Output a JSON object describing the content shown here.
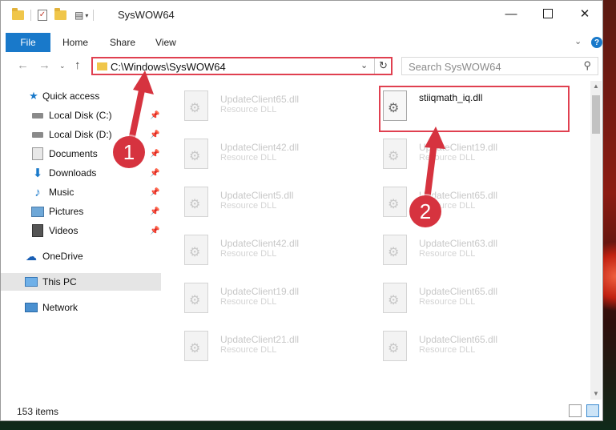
{
  "window": {
    "title": "SysWOW64"
  },
  "ribbon": {
    "tabs": [
      {
        "label": "File"
      },
      {
        "label": "Home"
      },
      {
        "label": "Share"
      },
      {
        "label": "View"
      }
    ]
  },
  "address": {
    "path": "C:\\Windows\\SysWOW64"
  },
  "search": {
    "placeholder": "Search SysWOW64"
  },
  "nav": {
    "items": [
      {
        "label": "Quick access",
        "icon": "star-icon",
        "pinned": false
      },
      {
        "label": "Local Disk (C:)",
        "icon": "drive-icon",
        "pinned": true
      },
      {
        "label": "Local Disk (D:)",
        "icon": "drive-icon",
        "pinned": true
      },
      {
        "label": "Documents",
        "icon": "documents-icon",
        "pinned": true
      },
      {
        "label": "Downloads",
        "icon": "download-icon",
        "pinned": true
      },
      {
        "label": "Music",
        "icon": "music-icon",
        "pinned": true
      },
      {
        "label": "Pictures",
        "icon": "pictures-icon",
        "pinned": true
      },
      {
        "label": "Videos",
        "icon": "videos-icon",
        "pinned": true
      },
      {
        "label": "OneDrive",
        "icon": "cloud-icon",
        "pinned": false
      },
      {
        "label": "This PC",
        "icon": "computer-icon",
        "pinned": false,
        "selected": true
      },
      {
        "label": "Network",
        "icon": "network-icon",
        "pinned": false
      }
    ]
  },
  "files": {
    "left": [
      {
        "name": "UpdateClient65.dll",
        "type": "Resource DLL"
      },
      {
        "name": "UpdateClient42.dll",
        "type": "Resource DLL"
      },
      {
        "name": "UpdateClient5.dll",
        "type": "Resource DLL"
      },
      {
        "name": "UpdateClient42.dll",
        "type": "Resource DLL"
      },
      {
        "name": "UpdateClient19.dll",
        "type": "Resource DLL"
      },
      {
        "name": "UpdateClient21.dll",
        "type": "Resource DLL"
      }
    ],
    "right": [
      {
        "name": "stiiqmath_iq.dll",
        "type": "",
        "highlighted": true
      },
      {
        "name": "UpdateClient19.dll",
        "type": "Resource DLL"
      },
      {
        "name": "UpdateClient65.dll",
        "type": "Resource DLL"
      },
      {
        "name": "UpdateClient63.dll",
        "type": "Resource DLL"
      },
      {
        "name": "UpdateClient65.dll",
        "type": "Resource DLL"
      },
      {
        "name": "UpdateClient65.dll",
        "type": "Resource DLL"
      }
    ]
  },
  "status": {
    "count": "153 items"
  },
  "annotations": {
    "step1": "1",
    "step2": "2",
    "color": "#d6333f"
  }
}
